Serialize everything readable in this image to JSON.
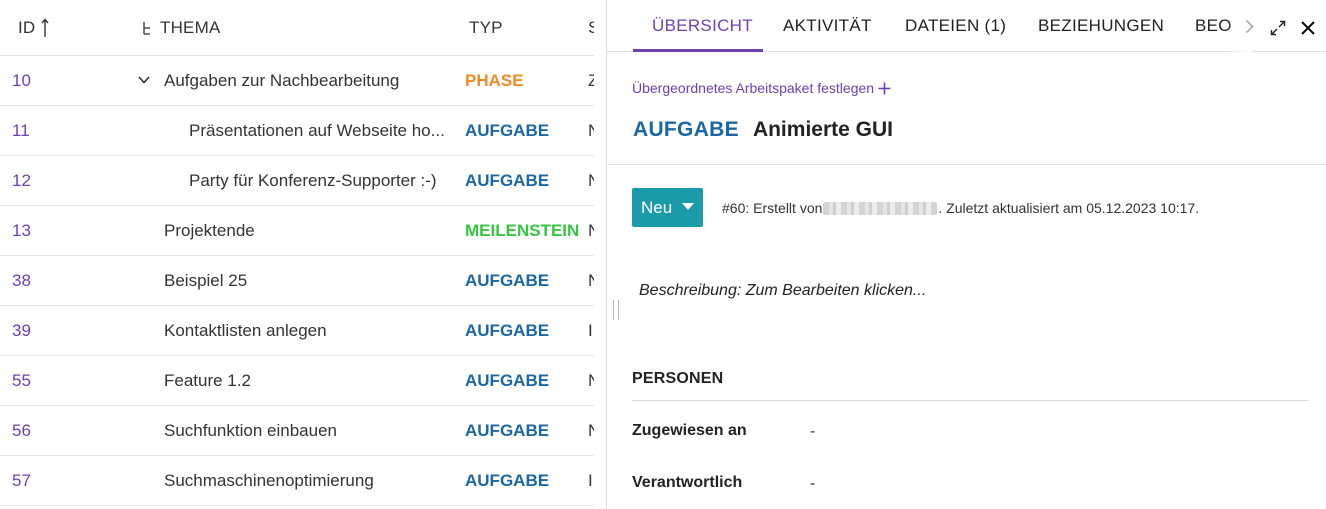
{
  "table": {
    "headers": {
      "id": "ID",
      "subject": "THEMA",
      "type": "TYP",
      "status": "S"
    },
    "rows": [
      {
        "id": "10",
        "subject": "Aufgaben zur Nachbearbeitung",
        "type": "PHASE",
        "status": "Z",
        "type_class": "t-phase",
        "indent": 164,
        "expandable": true
      },
      {
        "id": "11",
        "subject": "Präsentationen auf Webseite ho...",
        "type": "AUFGABE",
        "status": "N",
        "type_class": "t-task",
        "indent": 189,
        "expandable": false
      },
      {
        "id": "12",
        "subject": "Party für Konferenz-Supporter :-)",
        "type": "AUFGABE",
        "status": "N",
        "type_class": "t-task",
        "indent": 189,
        "expandable": false
      },
      {
        "id": "13",
        "subject": "Projektende",
        "type": "MEILENSTEIN",
        "status": "N",
        "type_class": "t-milestone",
        "indent": 164,
        "expandable": false
      },
      {
        "id": "38",
        "subject": "Beispiel 25",
        "type": "AUFGABE",
        "status": "N",
        "type_class": "t-task",
        "indent": 164,
        "expandable": false
      },
      {
        "id": "39",
        "subject": "Kontaktlisten anlegen",
        "type": "AUFGABE",
        "status": "I",
        "type_class": "t-task",
        "indent": 164,
        "expandable": false
      },
      {
        "id": "55",
        "subject": "Feature 1.2",
        "type": "AUFGABE",
        "status": "N",
        "type_class": "t-task",
        "indent": 164,
        "expandable": false
      },
      {
        "id": "56",
        "subject": "Suchfunktion einbauen",
        "type": "AUFGABE",
        "status": "N",
        "type_class": "t-task",
        "indent": 164,
        "expandable": false
      },
      {
        "id": "57",
        "subject": "Suchmaschinenoptimierung",
        "type": "AUFGABE",
        "status": "I",
        "type_class": "t-task",
        "indent": 164,
        "expandable": false
      }
    ]
  },
  "panel": {
    "tabs": [
      {
        "label": "ÜBERSICHT",
        "active": true
      },
      {
        "label": "AKTIVITÄT",
        "active": false
      },
      {
        "label": "DATEIEN (1)",
        "active": false
      },
      {
        "label": "BEZIEHUNGEN",
        "active": false
      },
      {
        "label": "BEO",
        "active": false
      }
    ],
    "parent_link": "Übergeordnetes Arbeitspaket festlegen",
    "wp_type": "AUFGABE",
    "wp_subject": "Animierte GUI",
    "status": "Neu",
    "meta_prefix": "#60: Erstellt von",
    "meta_suffix": ". Zuletzt aktualisiert am 05.12.2023 10:17.",
    "description_placeholder": "Beschreibung: Zum Bearbeiten klicken...",
    "section_people": "PERSONEN",
    "attributes": [
      {
        "label": "Zugewiesen an",
        "value": "-"
      },
      {
        "label": "Verantwortlich",
        "value": "-"
      }
    ]
  },
  "colors": {
    "accent": "#6f3fb0",
    "task": "#1a67a3",
    "phase": "#f08a24",
    "milestone": "#35c53f",
    "status_button": "#1b9aaa"
  }
}
